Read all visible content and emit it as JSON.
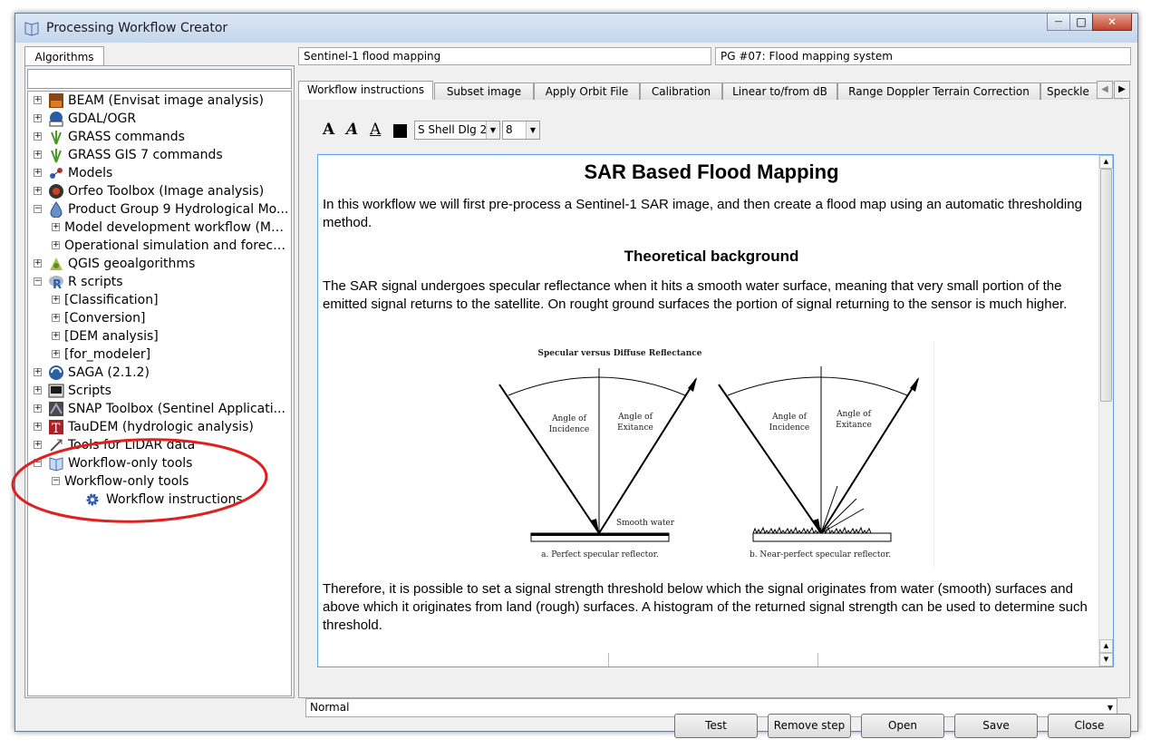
{
  "window": {
    "title": "Processing Workflow Creator",
    "minimize": "—",
    "maximize": "□",
    "close": "✕"
  },
  "left_panel": {
    "tab_label": "Algorithms",
    "search_value": "",
    "tree": [
      {
        "label": "BEAM (Envisat image analysis)",
        "expander": "+",
        "icon": "beam-icon"
      },
      {
        "label": "GDAL/OGR",
        "expander": "+",
        "icon": "gdal-icon"
      },
      {
        "label": "GRASS commands",
        "expander": "+",
        "icon": "grass-icon"
      },
      {
        "label": "GRASS GIS 7 commands",
        "expander": "+",
        "icon": "grass-icon"
      },
      {
        "label": "Models",
        "expander": "+",
        "icon": "models-icon"
      },
      {
        "label": "Orfeo Toolbox (Image analysis)",
        "expander": "+",
        "icon": "orfeo-icon"
      },
      {
        "label": "Product Group 9 Hydrological Mo...",
        "expander": "−",
        "icon": "hydrology-icon"
      },
      {
        "label": "Model development workflow (MD...",
        "expander": "+",
        "icon": ""
      },
      {
        "label": "Operational simulation and forecas...",
        "expander": "+",
        "icon": ""
      },
      {
        "label": "QGIS geoalgorithms",
        "expander": "+",
        "icon": "qgis-icon"
      },
      {
        "label": "R scripts",
        "expander": "−",
        "icon": "r-icon"
      },
      {
        "label": "[Classification]",
        "expander": "+",
        "icon": ""
      },
      {
        "label": "[Conversion]",
        "expander": "+",
        "icon": ""
      },
      {
        "label": "[DEM analysis]",
        "expander": "+",
        "icon": ""
      },
      {
        "label": "[for_modeler]",
        "expander": "+",
        "icon": ""
      },
      {
        "label": "SAGA (2.1.2)",
        "expander": "+",
        "icon": "saga-icon"
      },
      {
        "label": "Scripts",
        "expander": "+",
        "icon": "scripts-icon"
      },
      {
        "label": "SNAP Toolbox (Sentinel Applicati...",
        "expander": "+",
        "icon": "snap-icon"
      },
      {
        "label": "TauDEM (hydrologic analysis)",
        "expander": "+",
        "icon": "taudem-icon"
      },
      {
        "label": "Tools for LiDAR data",
        "expander": "+",
        "icon": "lidar-icon"
      },
      {
        "label": "Workflow-only tools",
        "expander": "−",
        "icon": "workflow-icon"
      },
      {
        "label": "Workflow-only tools",
        "expander": "−",
        "icon": ""
      },
      {
        "label": "Workflow instructions",
        "expander": "",
        "icon": "gear-icon"
      }
    ]
  },
  "header": {
    "workflow_name": "Sentinel-1 flood mapping",
    "product_group": "PG #07: Flood mapping system"
  },
  "tabs": [
    "Workflow instructions",
    "Subset image",
    "Apply Orbit File",
    "Calibration",
    "Linear to/from dB",
    "Range Doppler Terrain Correction",
    "Speckle"
  ],
  "tab_nav": {
    "prev": "◀",
    "next": "▶"
  },
  "toolbar": {
    "bold_glyph": "A",
    "italic_glyph": "A",
    "underline_glyph": "A",
    "font_name": "S Shell Dlg 2",
    "font_size": "8",
    "text_color": "#000000"
  },
  "document": {
    "heading": "SAR Based Flood Mapping",
    "intro": "In this workflow we will first pre-process a Sentinel-1 SAR image, and then create a flood map using an automatic thresholding method.",
    "subheading": "Theoretical background",
    "para1": "The SAR signal undergoes specular reflectance when it hits a smooth water surface, meaning that very small portion of the emitted signal returns to the satellite. On rought ground surfaces the portion of signal returning to the sensor is much higher.",
    "figure": {
      "title": "Specular versus Diffuse Reflectance",
      "angle_incidence": [
        "Angle of",
        "Incidence"
      ],
      "angle_exitance": [
        "Angle of",
        "Exitance"
      ],
      "smooth_water": "Smooth water",
      "caption_a": "a. Perfect specular reflector.",
      "caption_b": "b. Near-perfect specular reflector."
    },
    "para2": "Therefore, it is possible to set a signal strength threshold below which the signal originates from water (smooth) surfaces and above which it originates from land (rough) surfaces. A histogram of the returned signal strength can be used to determine such threshold."
  },
  "mode_select": "Normal",
  "buttons": {
    "test": "Test",
    "remove_step": "Remove step",
    "open": "Open",
    "save": "Save",
    "close": "Close"
  },
  "colors": {
    "annotation_circle": "#e02020",
    "selection_border": "#5ea0e0"
  }
}
